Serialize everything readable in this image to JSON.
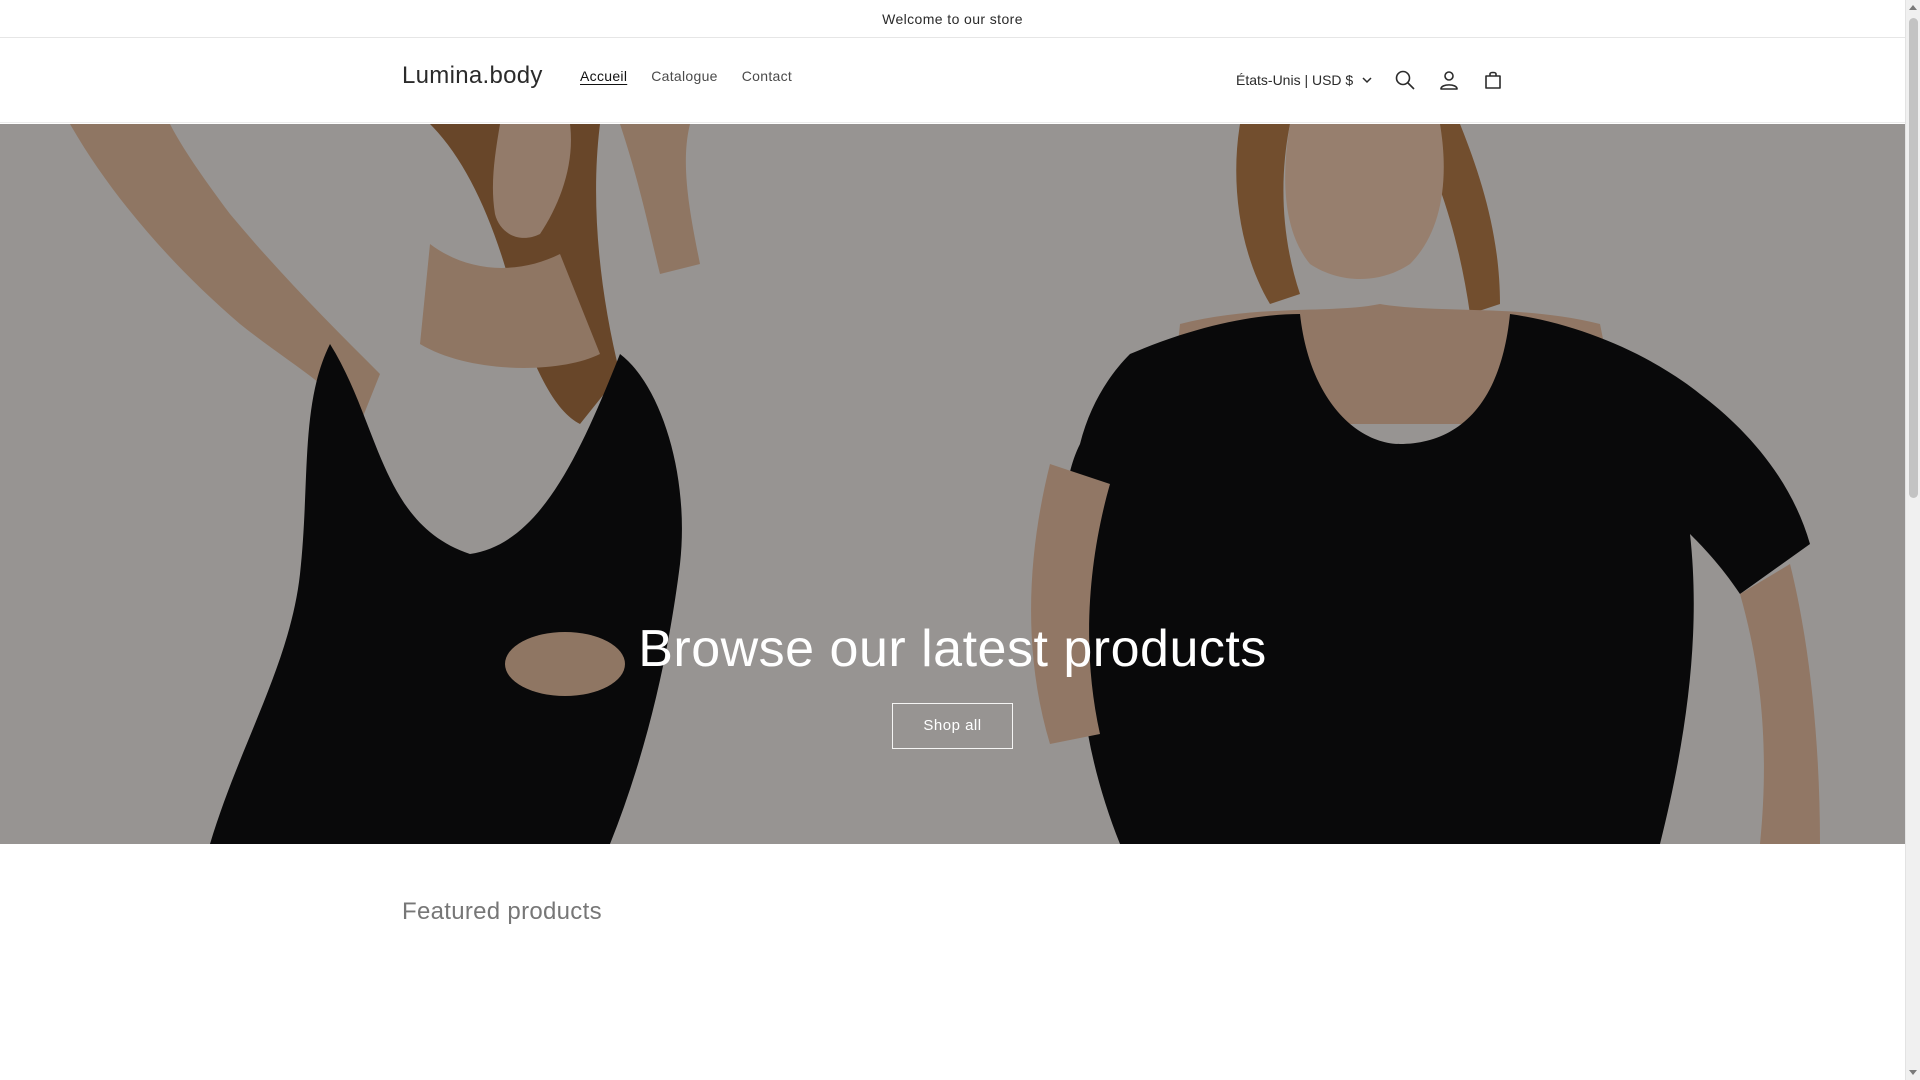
{
  "announcement": {
    "text": "Welcome to our store"
  },
  "header": {
    "logo": "Lumina.body",
    "nav": [
      {
        "label": "Accueil",
        "active": true
      },
      {
        "label": "Catalogue",
        "active": false
      },
      {
        "label": "Contact",
        "active": false
      }
    ],
    "locale": "États-Unis | USD $",
    "icons": [
      "chevron-down-icon",
      "search-icon",
      "account-icon",
      "cart-icon"
    ]
  },
  "hero": {
    "title": "Browse our latest products",
    "button": "Shop all"
  },
  "featured": {
    "title": "Featured products"
  },
  "colors": {
    "garment": "#0e0e10",
    "skin_light": "#d9b49a",
    "hair": "#9a6840",
    "overlay": "rgba(0,0,0,0.35)"
  }
}
